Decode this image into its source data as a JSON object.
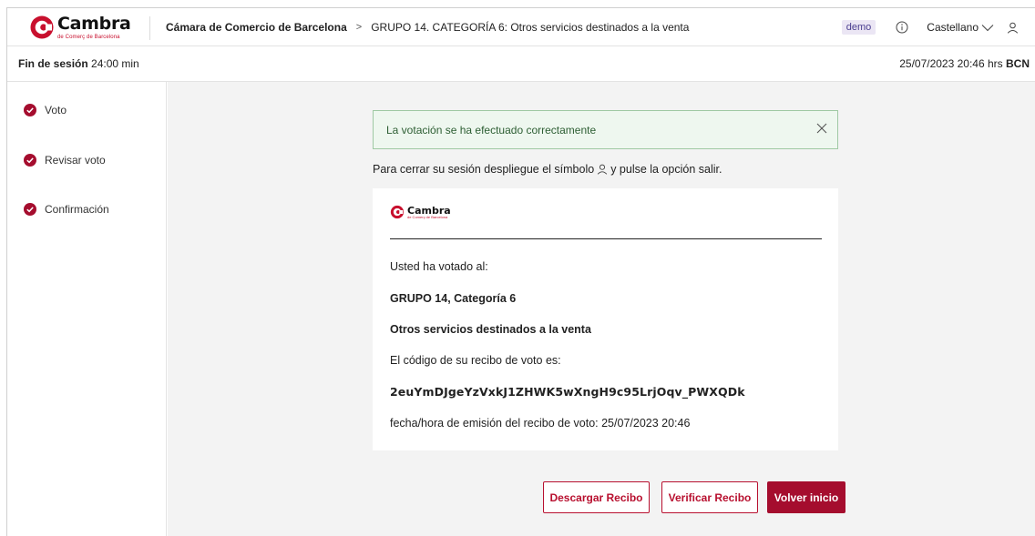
{
  "brand": {
    "name": "Cambra",
    "subtitle": "de Comerç de Barcelona",
    "accent": "#a50d2e"
  },
  "header": {
    "breadcrumb": {
      "organization": "Cámara de Comercio de Barcelona",
      "separator": ">",
      "current": "GRUPO 14. CATEGORÍA 6: Otros servicios destinados a la venta"
    },
    "demo_badge": "demo",
    "language": "Castellano",
    "icons": {
      "info": "info-circle-icon",
      "language": "chevron-down-icon",
      "user": "user-icon"
    }
  },
  "session": {
    "label": "Fin de sesión",
    "remaining": "24:00 min",
    "datetime": "25/07/2023 20:46 hrs",
    "city": "BCN"
  },
  "sidebar": {
    "steps": [
      {
        "label": "Voto",
        "status": "completed"
      },
      {
        "label": "Revisar voto",
        "status": "completed"
      },
      {
        "label": "Confirmación",
        "status": "completed"
      }
    ]
  },
  "main": {
    "alert": {
      "message": "La votación se ha efectuado correctamente",
      "color": "#eef7ef"
    },
    "instruction": {
      "before": "Para cerrar su sesión despliegue el símbolo",
      "after": "y pulse la opción salir."
    },
    "receipt": {
      "intro": "Usted ha votado al:",
      "group": "GRUPO 14, Categoría 6",
      "category": "Otros servicios destinados a la venta",
      "code_label": "El código de su recibo de voto es:",
      "code": "2euYmDJgeYzVxkJ1ZHWK5wXngH9c95LrjOqv_PWXQDk",
      "issue_label": "fecha/hora de emisión del recibo de voto:",
      "issue_datetime": "25/07/2023 20:46"
    },
    "buttons": {
      "download": "Descargar Recibo",
      "verify": "Verificar Recibo",
      "home": "Volver inicio"
    }
  }
}
